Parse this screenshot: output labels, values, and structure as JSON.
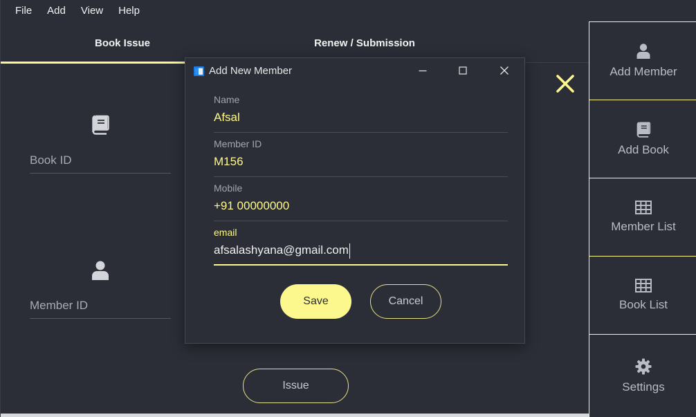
{
  "menu": [
    "File",
    "Add",
    "View",
    "Help"
  ],
  "tabs": {
    "book_issue": "Book Issue",
    "renew_submission": "Renew / Submission"
  },
  "issue_form": {
    "book_id_label": "Book ID",
    "member_id_label": "Member ID",
    "issue_button": "Issue"
  },
  "side_panel": {
    "items": [
      {
        "label": "Add Member",
        "icon": "user-icon"
      },
      {
        "label": "Add Book",
        "icon": "book-icon"
      },
      {
        "label": "Member List",
        "icon": "table-icon"
      },
      {
        "label": "Book List",
        "icon": "table-icon"
      },
      {
        "label": "Settings",
        "icon": "gear-icon"
      }
    ]
  },
  "dialog": {
    "title": "Add New Member",
    "fields": [
      {
        "label": "Name",
        "value": "Afsal"
      },
      {
        "label": "Member ID",
        "value": "M156"
      },
      {
        "label": "Mobile",
        "value": "+91 00000000"
      },
      {
        "label": "email",
        "value": "afsalashyana@gmail.com"
      }
    ],
    "save_label": "Save",
    "cancel_label": "Cancel"
  },
  "colors": {
    "background": "#2b2e37",
    "accent": "#fdf88d",
    "text": "#f2f2f2",
    "muted": "#a8abb2"
  }
}
